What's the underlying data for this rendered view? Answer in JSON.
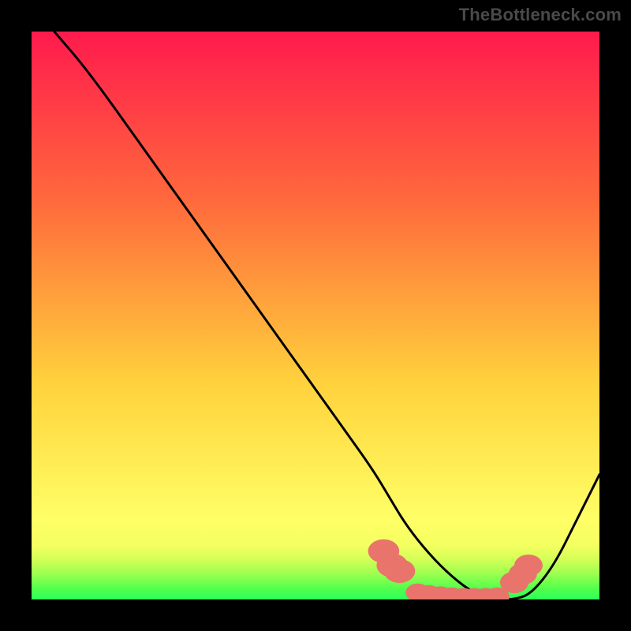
{
  "watermark": "TheBottleneck.com",
  "colors": {
    "frame": "#000000",
    "gradient_top": "#ff1a4d",
    "gradient_mid1": "#ff6a3c",
    "gradient_mid2": "#ffd23c",
    "gradient_mid3": "#ffff66",
    "gradient_bottom": "#2aff5a",
    "curve": "#000000",
    "marker": "#e8746c"
  },
  "chart_data": {
    "type": "line",
    "title": "",
    "xlabel": "",
    "ylabel": "",
    "xlim": [
      0,
      100
    ],
    "ylim": [
      0,
      100
    ],
    "series": [
      {
        "name": "curve",
        "x": [
          4,
          10,
          20,
          30,
          40,
          50,
          55,
          60,
          63,
          66,
          70,
          74,
          78,
          82,
          85,
          88,
          92,
          96,
          100
        ],
        "y": [
          100,
          93,
          79,
          65,
          51,
          37,
          30,
          23,
          18,
          13,
          8,
          4,
          1,
          0,
          0,
          1,
          6,
          14,
          22
        ]
      }
    ],
    "markers": {
      "name": "cluster",
      "points": [
        {
          "x": 62,
          "y": 8.5,
          "r": 2.2
        },
        {
          "x": 63.5,
          "y": 6.0,
          "r": 2.2
        },
        {
          "x": 64.8,
          "y": 5.0,
          "r": 2.2
        },
        {
          "x": 68,
          "y": 1.2,
          "r": 1.7
        },
        {
          "x": 70,
          "y": 0.9,
          "r": 1.7
        },
        {
          "x": 72,
          "y": 0.7,
          "r": 1.7
        },
        {
          "x": 74,
          "y": 0.5,
          "r": 1.7
        },
        {
          "x": 76,
          "y": 0.4,
          "r": 1.7
        },
        {
          "x": 78,
          "y": 0.4,
          "r": 1.7
        },
        {
          "x": 80,
          "y": 0.4,
          "r": 1.7
        },
        {
          "x": 82,
          "y": 0.5,
          "r": 1.7
        },
        {
          "x": 85,
          "y": 3.0,
          "r": 2.0
        },
        {
          "x": 86.5,
          "y": 4.5,
          "r": 2.0
        },
        {
          "x": 87.5,
          "y": 6.0,
          "r": 2.0
        }
      ]
    },
    "gradient_bands": [
      {
        "y_from": 100,
        "y_to": 10,
        "stops": [
          "#ff1a4d",
          "#ff6a3c",
          "#ffd23c",
          "#ffff66"
        ]
      },
      {
        "y_from": 10,
        "y_to": 0,
        "stops": [
          "#ffff66",
          "#e8ff5a",
          "#b0ff52",
          "#70ff4e",
          "#2aff5a"
        ]
      }
    ]
  }
}
